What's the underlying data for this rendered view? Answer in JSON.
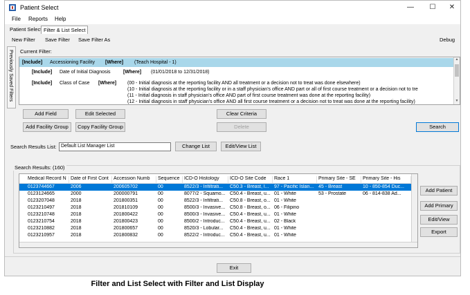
{
  "window": {
    "title": "Patient Select"
  },
  "window_controls": {
    "minimize": "—",
    "maximize": "☐",
    "close": "✕"
  },
  "menu": [
    "File",
    "Reports",
    "Help"
  ],
  "tabs": [
    "Patient Select",
    "Filter & List Select"
  ],
  "toolbar": {
    "new_filter": "New Filter",
    "save_filter": "Save Filter",
    "save_filter_as": "Save Filter As",
    "debug": "Debug"
  },
  "sidebar": {
    "label": "Previously Saved Filters"
  },
  "current_filter": {
    "label": "Current Filter:",
    "rows": [
      {
        "tag": "[Include]",
        "field": "Accessioning Facility",
        "where": "[Where]",
        "value": "(Teach Hospital - 1)"
      },
      {
        "tag": "[Include]",
        "field": "Date of Initial Diagnosis",
        "where": "[Where]",
        "value": "(01/01/2018 to 12/31/2018)"
      },
      {
        "tag": "[Include]",
        "field": "Class of Case",
        "where": "[Where]",
        "lines": [
          "(00 - Initial diagnosis at the reporting facility AND all treatment or a decision not to treat was done elsewhere)",
          "(10 - Initial diagnosis at the reporting facility or in a staff physician's office AND part or all of first course treatment or a decision not to tre",
          "(11 - Initial diagnosis in staff physician's office AND part of first course treatment was done at the reporting facility)",
          "(12 - Initial diagnosis in staff physician's office AND all first course treatment or a decision not to treat was done at the reporting facility)"
        ]
      }
    ]
  },
  "buttons": {
    "add_field": "Add Field",
    "edit_selected": "Edit Selected",
    "clear_criteria": "Clear Criteria",
    "add_facility_group": "Add Facility Group",
    "copy_facility_group": "Copy Facility Group",
    "delete": "Delete",
    "search": "Search",
    "change_list": "Change List",
    "edit_view_list": "Edit/View List",
    "add_patient": "Add Patient",
    "add_primary": "Add Primary",
    "edit_view": "Edit/View",
    "export": "Export",
    "exit": "Exit"
  },
  "search_results_list": {
    "label": "Search Results List:",
    "value": "Default List Manager List"
  },
  "search_results": {
    "label": "Search Results: (160)",
    "columns": [
      "Medical Record N",
      "Date of First Cont",
      "Accession Numb",
      "Sequence",
      "ICD-O Histology",
      "ICD-O Site Code",
      "Race 1",
      "Primary Site - SE",
      "Primary Site - His"
    ],
    "rows": [
      [
        "0123744667",
        "2006",
        "200605702",
        "00",
        "8522/3 - Infiltrati...",
        "C50.3 - Breast, l...",
        "97 - Pacific Islan...",
        "45 - Breast",
        "10 - 850-854 Duc..."
      ],
      [
        "0123124665",
        "2000",
        "200000791",
        "00",
        "8077/2 - Squamo...",
        "C50.4 - Breast, u...",
        "01 - White",
        "53 - Prostate",
        "06 - 814-838 Ad..."
      ],
      [
        "0123207048",
        "2018",
        "201800351",
        "00",
        "8522/3 - Infiltrati...",
        "C50.8 - Breast, o...",
        "01 - White",
        "",
        ""
      ],
      [
        "0123210497",
        "2018",
        "201810109",
        "00",
        "8500/3 - Invasive...",
        "C50.8 - Breast, o...",
        "06 - Filipino",
        "",
        ""
      ],
      [
        "0123210748",
        "2018",
        "201800422",
        "00",
        "8500/3 - Invasive...",
        "C50.4 - Breast, u...",
        "01 - White",
        "",
        ""
      ],
      [
        "0123210754",
        "2018",
        "201800423",
        "00",
        "8500/2 - Introduc...",
        "C50.4 - Breast, u...",
        "02 - Black",
        "",
        ""
      ],
      [
        "0123210882",
        "2018",
        "201800657",
        "00",
        "8520/3 - Lobular...",
        "C50.4 - Breast, u...",
        "01 - White",
        "",
        ""
      ],
      [
        "0123210957",
        "2018",
        "201800832",
        "00",
        "8522/2 - Introduc...",
        "C50.4 - Breast, u...",
        "01 - White",
        "",
        ""
      ]
    ]
  },
  "caption": "Filter and List Select with Filter and List Display"
}
